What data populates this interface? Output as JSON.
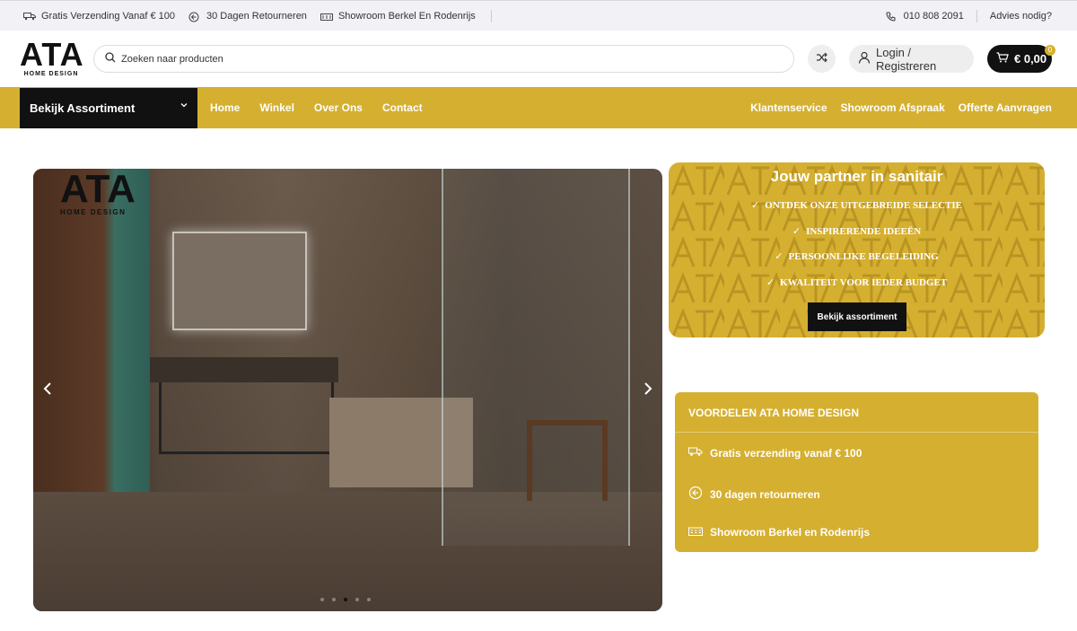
{
  "topbar": {
    "left": [
      {
        "icon": "truck-icon",
        "text": "Gratis Verzending Vanaf € 100"
      },
      {
        "icon": "return-icon",
        "text": "30 Dagen Retourneren"
      },
      {
        "icon": "showroom-icon",
        "text": "Showroom Berkel En Rodenrijs"
      }
    ],
    "phone": "010 808 2091",
    "advice": "Advies nodig?"
  },
  "header": {
    "logo_main": "ATA",
    "logo_sub": "HOME DESIGN",
    "search_placeholder": "Zoeken naar producten",
    "login_label": "Login / Registreren",
    "cart_amount": "€ 0,00",
    "cart_count": "0"
  },
  "nav": {
    "assortment_label": "Bekijk Assortiment",
    "links": [
      "Home",
      "Winkel",
      "Over Ons",
      "Contact"
    ],
    "right_links": [
      "Klantenservice",
      "Showroom Afspraak",
      "Offerte Aanvragen"
    ]
  },
  "hero": {
    "logo_main": "ATA",
    "logo_sub": "HOME DESIGN",
    "slide_count": 5,
    "active_slide": 3
  },
  "promo": {
    "title": "Jouw partner in sanitair",
    "items": [
      "ONTDEK ONZE UITGEBREIDE SELECTIE",
      "INSPIRERENDE IDEEËN",
      "PERSOONLIJKE BEGELEIDING",
      "KWALITEIT VOOR IEDER BUDGET"
    ],
    "button_label": "Bekijk assortiment"
  },
  "benefits": {
    "title": "VOORDELEN ATA HOME DESIGN",
    "items": [
      {
        "icon": "truck-icon",
        "text": "Gratis verzending vanaf € 100"
      },
      {
        "icon": "return-icon",
        "text": "30 dagen retourneren"
      },
      {
        "icon": "showroom-icon",
        "text": "Showroom Berkel en Rodenrijs"
      }
    ]
  },
  "colors": {
    "accent": "#d5af30",
    "dark": "#111111",
    "topbar_bg": "#f2f1f6"
  }
}
